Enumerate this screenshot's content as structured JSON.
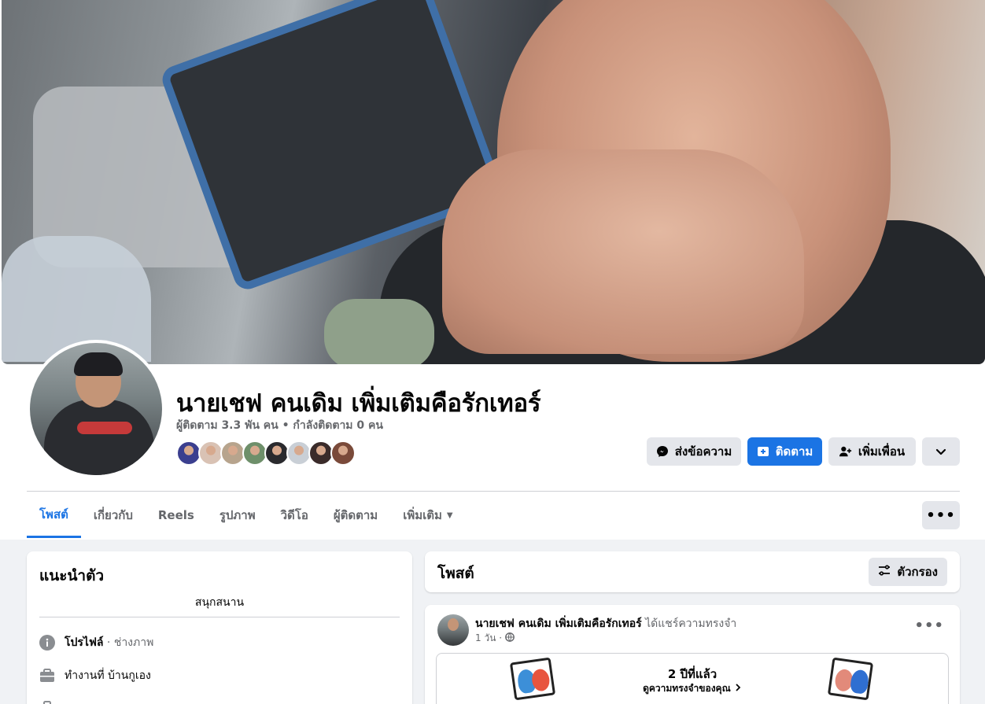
{
  "profile": {
    "name": "นายเชฟ คนเดิม เพิ่มเติมคือรักเทอร์",
    "stats": "ผู้ติดตาม 3.3 พัน คน • กำลังติดตาม 0 คน",
    "friend_colors": [
      "#3b3f8f",
      "#d9c2b4",
      "#b7a48d",
      "#6e8f6a",
      "#2a2a2e",
      "#c9cfd6",
      "#3a2b2a",
      "#7a4a3a"
    ]
  },
  "actions": {
    "message": "ส่งข้อความ",
    "follow": "ติดตาม",
    "add_friend": "เพิ่มเพื่อน"
  },
  "tabs": [
    {
      "label": "โพสต์",
      "active": true
    },
    {
      "label": "เกี่ยวกับ"
    },
    {
      "label": "Reels"
    },
    {
      "label": "รูปภาพ"
    },
    {
      "label": "วิดีโอ"
    },
    {
      "label": "ผู้ติดตาม"
    },
    {
      "label": "เพิ่มเติม"
    }
  ],
  "intro": {
    "title": "แนะนำตัว",
    "bio": "สนุกสนาน",
    "profile_label": "โปรไฟล์",
    "profile_sub": " · ช่างภาพ",
    "work": "ทำงานที่ บ้านกูเอง"
  },
  "posts": {
    "title": "โพสต์",
    "filter_label": "ตัวกรอง"
  },
  "post": {
    "author": "นายเชฟ คนเดิม เพิ่มเติมคือรักเทอร์",
    "action": " ได้แชร์ความทรงจำ",
    "time": "1 วัน ·",
    "memory_years": "2 ปีที่แล้ว",
    "memory_link": "ดูความทรงจำของคุณ"
  },
  "colors": {
    "accent": "#1b74e4",
    "button_grey": "#e4e6eb",
    "background": "#f0f2f5",
    "secondary_text": "#65676b"
  }
}
